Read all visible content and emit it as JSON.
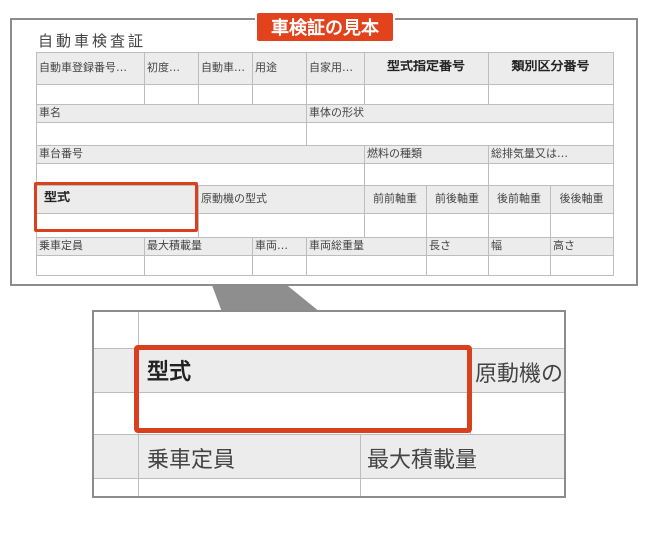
{
  "badge": "車検証の見本",
  "doc_title": "自動車検査証",
  "row1": [
    "自動車登録番号…",
    "初度…",
    "自動車…",
    "用途",
    "自家用…",
    "型式指定番号",
    "類別区分番号"
  ],
  "row2": [
    "車名",
    "車体の形状"
  ],
  "row3": [
    "車台番号",
    "燃料の種類",
    "総排気量又は…"
  ],
  "row4": [
    "型式",
    "原動機の型式",
    "前前軸重",
    "前後軸重",
    "後前軸重",
    "後後軸重"
  ],
  "row5": [
    "乗車定員",
    "最大積載量",
    "車両…",
    "車両総重量",
    "長さ",
    "幅",
    "高さ"
  ],
  "zoom": {
    "model": "型式",
    "engine": "原動機の",
    "capacity": "乗車定員",
    "max_load": "最大積載量"
  },
  "colors": {
    "accent": "#e2431d",
    "header_bg": "#ececec",
    "frame": "#8c8c8c"
  }
}
